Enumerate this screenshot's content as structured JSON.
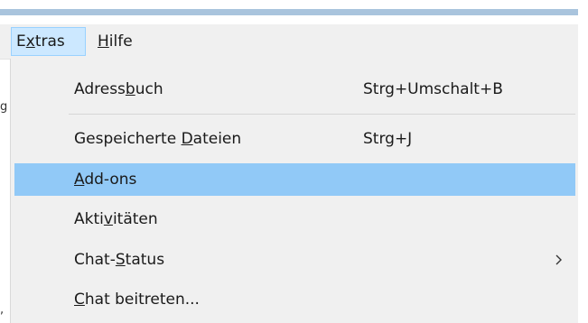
{
  "menubar": {
    "menus": [
      {
        "prefix": "E",
        "mnemonic": "x",
        "suffix": "tras",
        "open": true
      },
      {
        "prefix": "",
        "mnemonic": "H",
        "suffix": "ilfe",
        "open": false
      }
    ]
  },
  "edge_fragments": [
    "g",
    ","
  ],
  "menu": {
    "items": [
      {
        "prefix": "Adress",
        "mnemonic": "b",
        "suffix": "uch",
        "shortcut": "Strg+Umschalt+B"
      },
      {
        "prefix": "Gespeicherte ",
        "mnemonic": "D",
        "suffix": "ateien",
        "shortcut": "Strg+J"
      },
      {
        "prefix": "",
        "mnemonic": "A",
        "suffix": "dd-ons",
        "shortcut": "",
        "highlighted": true
      },
      {
        "prefix": "Akti",
        "mnemonic": "v",
        "suffix": "itäten",
        "shortcut": ""
      },
      {
        "prefix": "Chat-",
        "mnemonic": "S",
        "suffix": "tatus",
        "shortcut": "",
        "submenu": true
      },
      {
        "prefix": "",
        "mnemonic": "C",
        "suffix": "hat beitreten...",
        "shortcut": ""
      }
    ]
  },
  "colors": {
    "highlight": "#91c9f7",
    "menubar_active": "#cce8ff",
    "menu_bg": "#f0f0f0"
  },
  "icons": {
    "submenu": "chevron-right-icon"
  }
}
